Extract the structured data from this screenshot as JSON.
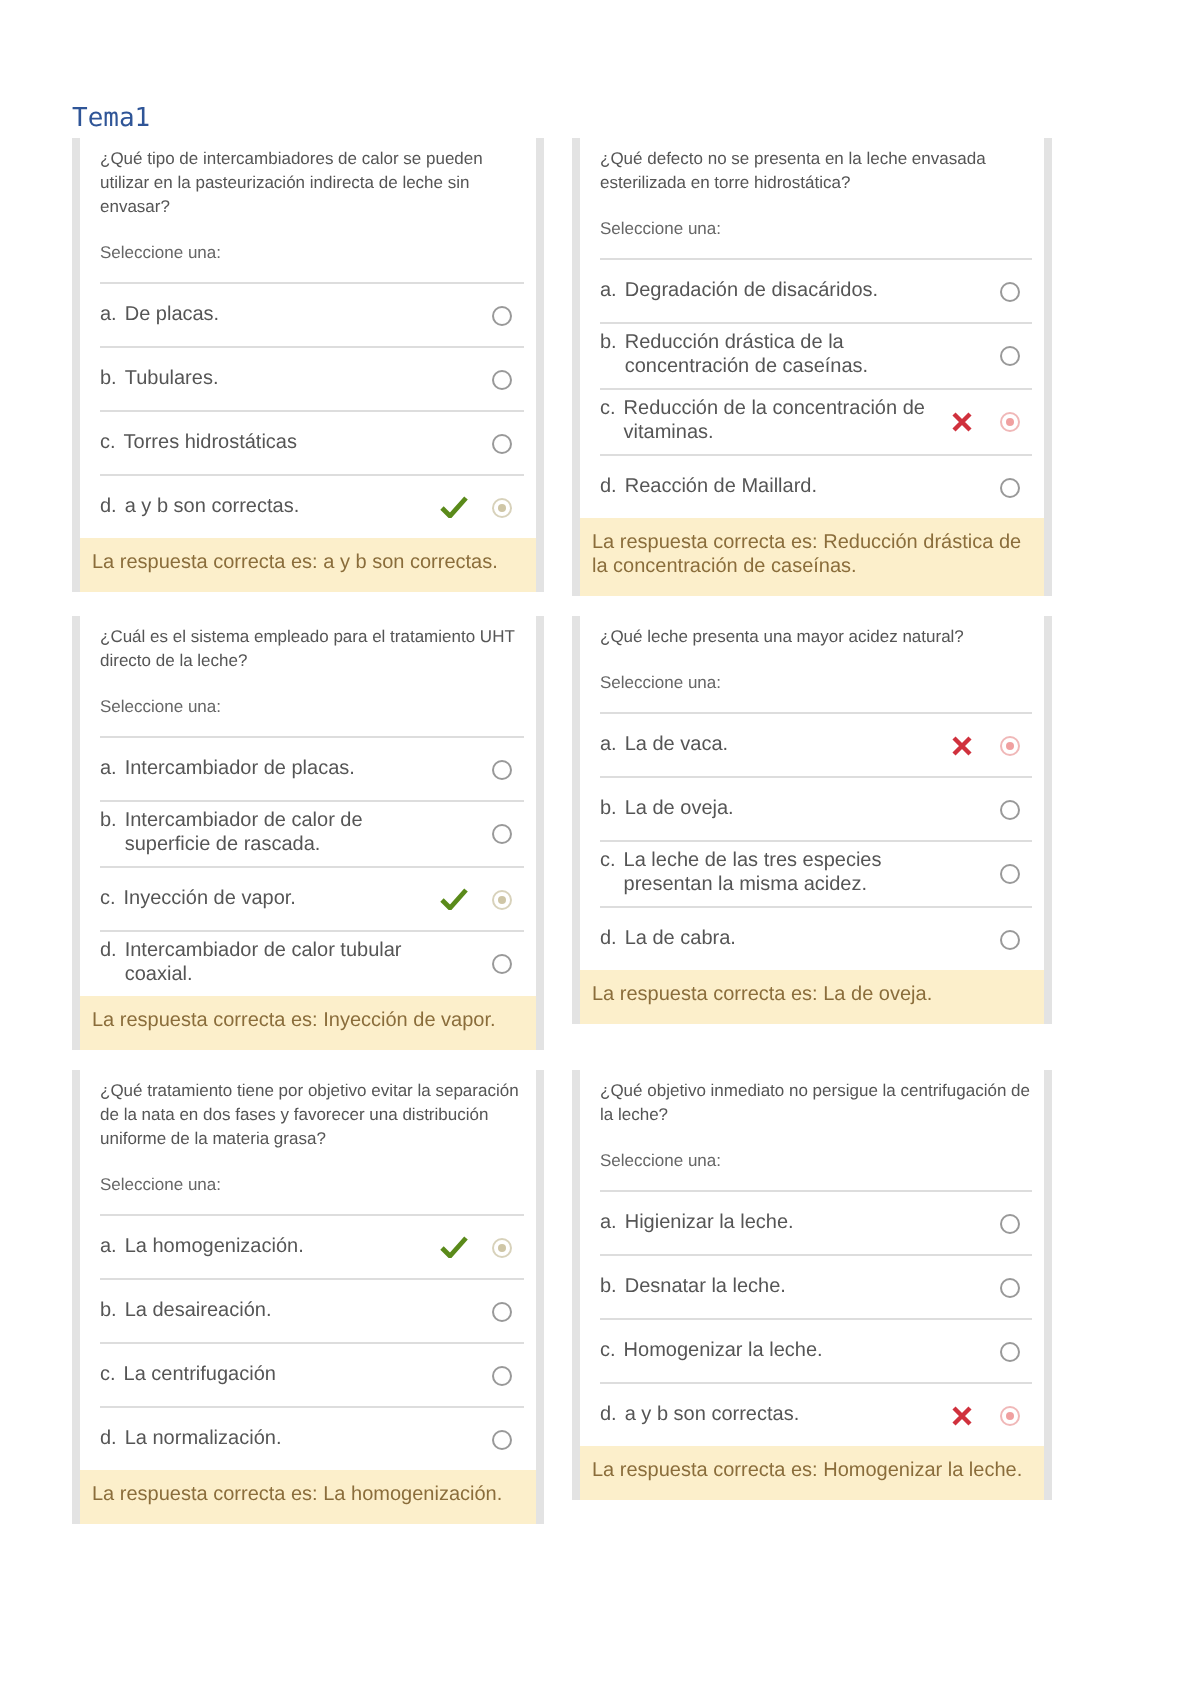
{
  "title": "Tema1",
  "questions": [
    {
      "question": "¿Qué tipo de intercambiadores de calor se pueden utilizar en la pasteurización indirecta de leche sin envasar?",
      "prompt": "Seleccione una:",
      "answer": "La respuesta correcta es: a y b son correctas.",
      "options": [
        {
          "letter": "a.",
          "text": "De placas.",
          "selected": false
        },
        {
          "letter": "b.",
          "text": "Tubulares.",
          "selected": false
        },
        {
          "letter": "c.",
          "text": "Torres hidrostáticas",
          "selected": false
        },
        {
          "letter": "d.",
          "text": "a y b son correctas.",
          "selected": true,
          "kind": "correct"
        }
      ]
    },
    {
      "question": "¿Qué defecto no se presenta en la leche envasada esterilizada en torre hidrostática?",
      "prompt": "Seleccione una:",
      "answer": "La respuesta correcta es: Reducción drástica de la concentración de caseínas.",
      "options": [
        {
          "letter": "a.",
          "text": "Degradación de disacáridos.",
          "selected": false
        },
        {
          "letter": "b.",
          "text": "Reducción drástica de la concentración de caseínas.",
          "selected": false
        },
        {
          "letter": "c.",
          "text": "Reducción de la concentración de vitaminas.",
          "selected": true,
          "kind": "incorrect"
        },
        {
          "letter": "d.",
          "text": "Reacción de Maillard.",
          "selected": false
        }
      ]
    },
    {
      "question": "¿Cuál es el sistema empleado para el tratamiento UHT directo de la leche?",
      "prompt": "Seleccione una:",
      "answer": "La respuesta correcta es: Inyección de vapor.",
      "options": [
        {
          "letter": "a.",
          "text": "Intercambiador de placas.",
          "selected": false
        },
        {
          "letter": "b.",
          "text": "Intercambiador de calor de superficie de rascada.",
          "selected": false
        },
        {
          "letter": "c.",
          "text": "Inyección de vapor.",
          "selected": true,
          "kind": "correct"
        },
        {
          "letter": "d.",
          "text": "Intercambiador de calor tubular coaxial.",
          "selected": false
        }
      ]
    },
    {
      "question": "¿Qué leche presenta una mayor acidez natural?",
      "prompt": "Seleccione una:",
      "answer": "La respuesta correcta es: La de oveja.",
      "options": [
        {
          "letter": "a.",
          "text": "La de vaca.",
          "selected": true,
          "kind": "incorrect"
        },
        {
          "letter": "b.",
          "text": "La de oveja.",
          "selected": false
        },
        {
          "letter": "c.",
          "text": "La leche de las tres especies presentan la misma acidez.",
          "selected": false
        },
        {
          "letter": "d.",
          "text": "La de cabra.",
          "selected": false
        }
      ]
    },
    {
      "question": "¿Qué tratamiento tiene por objetivo evitar la separación de la nata en dos fases y favorecer una distribución uniforme de la materia grasa?",
      "prompt": "Seleccione una:",
      "answer": "La respuesta correcta es: La homogenización.",
      "options": [
        {
          "letter": "a.",
          "text": "La homogenización.",
          "selected": true,
          "kind": "correct"
        },
        {
          "letter": "b.",
          "text": "La desaireación.",
          "selected": false
        },
        {
          "letter": "c.",
          "text": "La centrifugación",
          "selected": false
        },
        {
          "letter": "d.",
          "text": "La normalización.",
          "selected": false
        }
      ]
    },
    {
      "question": "¿Qué objetivo inmediato no persigue la centrifugación de la leche?",
      "prompt": "Seleccione una:",
      "answer": "La respuesta correcta es: Homogenizar la leche.",
      "options": [
        {
          "letter": "a.",
          "text": "Higienizar la leche.",
          "selected": false
        },
        {
          "letter": "b.",
          "text": "Desnatar la leche.",
          "selected": false
        },
        {
          "letter": "c.",
          "text": "Homogenizar la leche.",
          "selected": false
        },
        {
          "letter": "d.",
          "text": "a y b son correctas.",
          "selected": true,
          "kind": "incorrect"
        }
      ]
    }
  ]
}
